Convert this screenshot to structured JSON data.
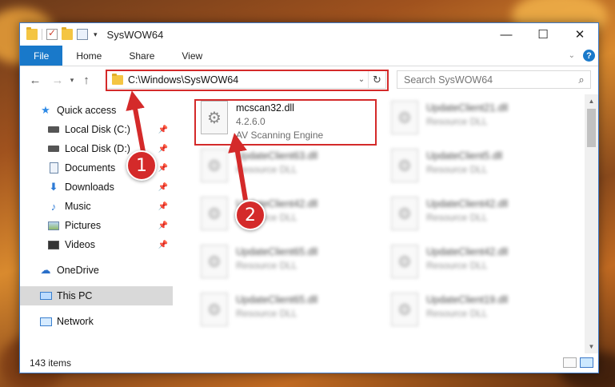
{
  "window": {
    "title": "SysWOW64",
    "controls": {
      "minimize": "—",
      "maximize": "☐",
      "close": "✕"
    }
  },
  "ribbon": {
    "tabs": [
      "File",
      "Home",
      "Share",
      "View"
    ],
    "help": "?"
  },
  "nav": {
    "address_path": "C:\\Windows\\SysWOW64",
    "search_placeholder": "Search SysWOW64"
  },
  "sidebar": {
    "quick_access": "Quick access",
    "items": [
      {
        "label": "Local Disk (C:)",
        "icon": "drive-icon"
      },
      {
        "label": "Local Disk (D:)",
        "icon": "drive-icon"
      },
      {
        "label": "Documents",
        "icon": "documents-icon"
      },
      {
        "label": "Downloads",
        "icon": "downloads-icon"
      },
      {
        "label": "Music",
        "icon": "music-icon"
      },
      {
        "label": "Pictures",
        "icon": "pictures-icon"
      },
      {
        "label": "Videos",
        "icon": "videos-icon"
      }
    ],
    "onedrive": "OneDrive",
    "this_pc": "This PC",
    "network": "Network"
  },
  "files": {
    "highlighted": {
      "name": "mcscan32.dll",
      "version": "4.2.6.0",
      "description": "AV Scanning Engine"
    },
    "blurred_left": [
      {
        "name": "UpdateClient63.dll",
        "sub": "Resource DLL"
      },
      {
        "name": "UpdateClient42.dll",
        "sub": "Resource DLL"
      },
      {
        "name": "UpdateClient65.dll",
        "sub": "Resource DLL"
      },
      {
        "name": "UpdateClient65.dll",
        "sub": "Resource DLL"
      }
    ],
    "blurred_right": [
      {
        "name": "UpdateClient21.dll",
        "sub": "Resource DLL"
      },
      {
        "name": "UpdateClient5.dll",
        "sub": "Resource DLL"
      },
      {
        "name": "UpdateClient42.dll",
        "sub": "Resource DLL"
      },
      {
        "name": "UpdateClient42.dll",
        "sub": "Resource DLL"
      },
      {
        "name": "UpdateClient19.dll",
        "sub": "Resource DLL"
      }
    ]
  },
  "status": {
    "item_count": "143 items"
  },
  "annotations": {
    "step1": "1",
    "step2": "2",
    "color": "#d42a2a"
  }
}
